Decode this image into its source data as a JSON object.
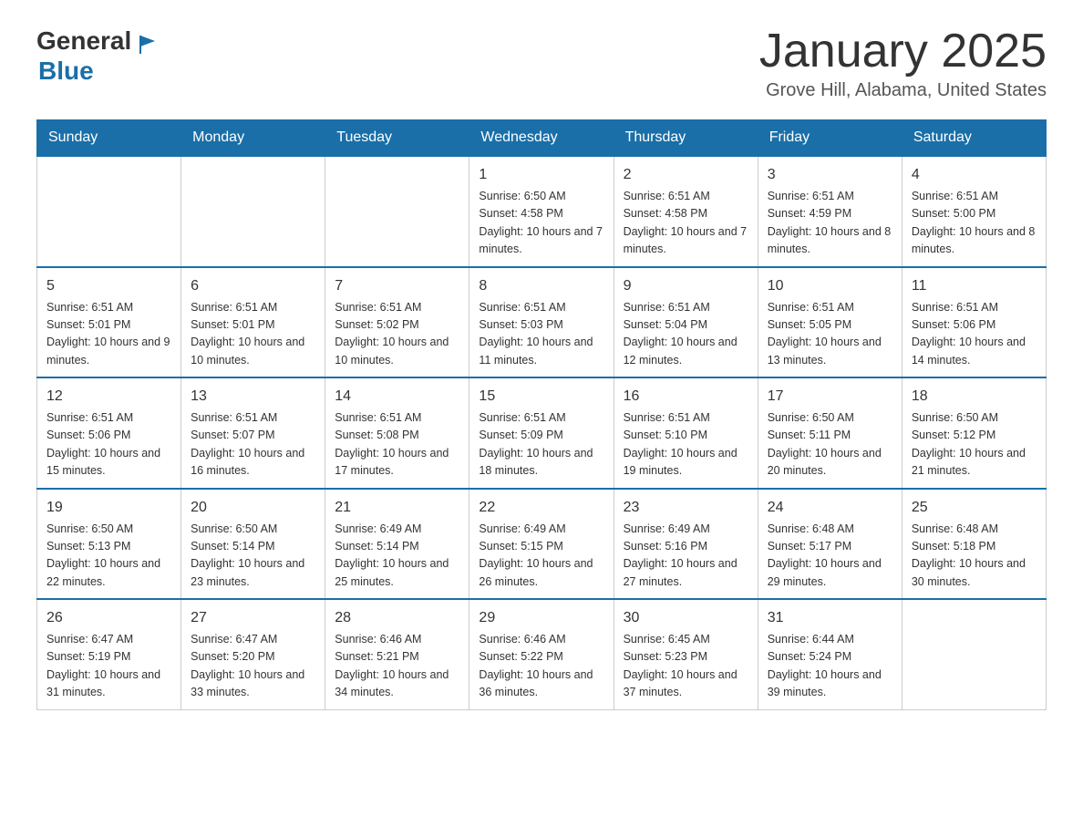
{
  "logo": {
    "general": "General",
    "blue": "Blue"
  },
  "title": "January 2025",
  "location": "Grove Hill, Alabama, United States",
  "weekdays": [
    "Sunday",
    "Monday",
    "Tuesday",
    "Wednesday",
    "Thursday",
    "Friday",
    "Saturday"
  ],
  "weeks": [
    [
      {
        "day": "",
        "info": ""
      },
      {
        "day": "",
        "info": ""
      },
      {
        "day": "",
        "info": ""
      },
      {
        "day": "1",
        "info": "Sunrise: 6:50 AM\nSunset: 4:58 PM\nDaylight: 10 hours\nand 7 minutes."
      },
      {
        "day": "2",
        "info": "Sunrise: 6:51 AM\nSunset: 4:58 PM\nDaylight: 10 hours\nand 7 minutes."
      },
      {
        "day": "3",
        "info": "Sunrise: 6:51 AM\nSunset: 4:59 PM\nDaylight: 10 hours\nand 8 minutes."
      },
      {
        "day": "4",
        "info": "Sunrise: 6:51 AM\nSunset: 5:00 PM\nDaylight: 10 hours\nand 8 minutes."
      }
    ],
    [
      {
        "day": "5",
        "info": "Sunrise: 6:51 AM\nSunset: 5:01 PM\nDaylight: 10 hours\nand 9 minutes."
      },
      {
        "day": "6",
        "info": "Sunrise: 6:51 AM\nSunset: 5:01 PM\nDaylight: 10 hours\nand 10 minutes."
      },
      {
        "day": "7",
        "info": "Sunrise: 6:51 AM\nSunset: 5:02 PM\nDaylight: 10 hours\nand 10 minutes."
      },
      {
        "day": "8",
        "info": "Sunrise: 6:51 AM\nSunset: 5:03 PM\nDaylight: 10 hours\nand 11 minutes."
      },
      {
        "day": "9",
        "info": "Sunrise: 6:51 AM\nSunset: 5:04 PM\nDaylight: 10 hours\nand 12 minutes."
      },
      {
        "day": "10",
        "info": "Sunrise: 6:51 AM\nSunset: 5:05 PM\nDaylight: 10 hours\nand 13 minutes."
      },
      {
        "day": "11",
        "info": "Sunrise: 6:51 AM\nSunset: 5:06 PM\nDaylight: 10 hours\nand 14 minutes."
      }
    ],
    [
      {
        "day": "12",
        "info": "Sunrise: 6:51 AM\nSunset: 5:06 PM\nDaylight: 10 hours\nand 15 minutes."
      },
      {
        "day": "13",
        "info": "Sunrise: 6:51 AM\nSunset: 5:07 PM\nDaylight: 10 hours\nand 16 minutes."
      },
      {
        "day": "14",
        "info": "Sunrise: 6:51 AM\nSunset: 5:08 PM\nDaylight: 10 hours\nand 17 minutes."
      },
      {
        "day": "15",
        "info": "Sunrise: 6:51 AM\nSunset: 5:09 PM\nDaylight: 10 hours\nand 18 minutes."
      },
      {
        "day": "16",
        "info": "Sunrise: 6:51 AM\nSunset: 5:10 PM\nDaylight: 10 hours\nand 19 minutes."
      },
      {
        "day": "17",
        "info": "Sunrise: 6:50 AM\nSunset: 5:11 PM\nDaylight: 10 hours\nand 20 minutes."
      },
      {
        "day": "18",
        "info": "Sunrise: 6:50 AM\nSunset: 5:12 PM\nDaylight: 10 hours\nand 21 minutes."
      }
    ],
    [
      {
        "day": "19",
        "info": "Sunrise: 6:50 AM\nSunset: 5:13 PM\nDaylight: 10 hours\nand 22 minutes."
      },
      {
        "day": "20",
        "info": "Sunrise: 6:50 AM\nSunset: 5:14 PM\nDaylight: 10 hours\nand 23 minutes."
      },
      {
        "day": "21",
        "info": "Sunrise: 6:49 AM\nSunset: 5:14 PM\nDaylight: 10 hours\nand 25 minutes."
      },
      {
        "day": "22",
        "info": "Sunrise: 6:49 AM\nSunset: 5:15 PM\nDaylight: 10 hours\nand 26 minutes."
      },
      {
        "day": "23",
        "info": "Sunrise: 6:49 AM\nSunset: 5:16 PM\nDaylight: 10 hours\nand 27 minutes."
      },
      {
        "day": "24",
        "info": "Sunrise: 6:48 AM\nSunset: 5:17 PM\nDaylight: 10 hours\nand 29 minutes."
      },
      {
        "day": "25",
        "info": "Sunrise: 6:48 AM\nSunset: 5:18 PM\nDaylight: 10 hours\nand 30 minutes."
      }
    ],
    [
      {
        "day": "26",
        "info": "Sunrise: 6:47 AM\nSunset: 5:19 PM\nDaylight: 10 hours\nand 31 minutes."
      },
      {
        "day": "27",
        "info": "Sunrise: 6:47 AM\nSunset: 5:20 PM\nDaylight: 10 hours\nand 33 minutes."
      },
      {
        "day": "28",
        "info": "Sunrise: 6:46 AM\nSunset: 5:21 PM\nDaylight: 10 hours\nand 34 minutes."
      },
      {
        "day": "29",
        "info": "Sunrise: 6:46 AM\nSunset: 5:22 PM\nDaylight: 10 hours\nand 36 minutes."
      },
      {
        "day": "30",
        "info": "Sunrise: 6:45 AM\nSunset: 5:23 PM\nDaylight: 10 hours\nand 37 minutes."
      },
      {
        "day": "31",
        "info": "Sunrise: 6:44 AM\nSunset: 5:24 PM\nDaylight: 10 hours\nand 39 minutes."
      },
      {
        "day": "",
        "info": ""
      }
    ]
  ]
}
